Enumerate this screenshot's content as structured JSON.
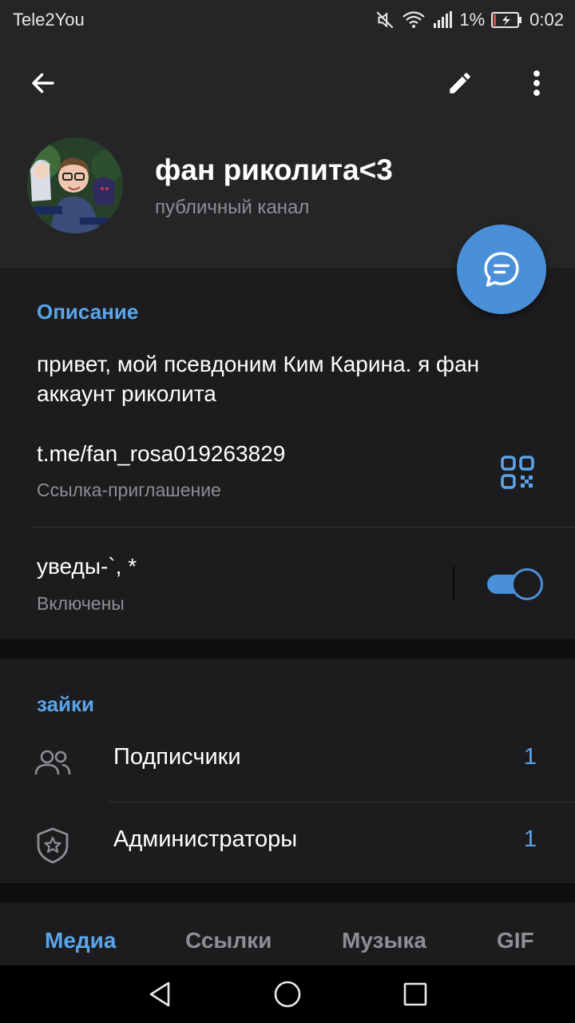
{
  "status_bar": {
    "carrier": "Tele2You",
    "battery": "1%",
    "time": "0:02",
    "icons": [
      "mute-icon",
      "wifi-icon",
      "signal-icon",
      "battery-charging-icon"
    ]
  },
  "header": {
    "back_icon": "arrow-left-icon",
    "edit_icon": "pencil-icon",
    "more_icon": "more-vertical-icon",
    "title": "фан риколита<3",
    "subtitle": "публичный канал"
  },
  "fab": {
    "icon": "chat-bubble-icon"
  },
  "info": {
    "description_title": "Описание",
    "description": "привет, мой псевдоним Ким Карина. я фан аккаунт риколита",
    "link": "t.me/fan_rosa019263829",
    "link_caption": "Ссылка-приглашение",
    "qr_icon": "qr-code-icon",
    "notifications_title": "уведы-`, *",
    "notifications_caption": "Включены",
    "notifications_enabled": true
  },
  "members": {
    "title": "зайки",
    "rows": [
      {
        "label": "Подписчики",
        "count": "1",
        "icon": "users-icon"
      },
      {
        "label": "Администраторы",
        "count": "1",
        "icon": "shield-star-icon"
      }
    ]
  },
  "tabs": [
    {
      "label": "Медиа",
      "active": true
    },
    {
      "label": "Ссылки",
      "active": false
    },
    {
      "label": "Музыка",
      "active": false
    },
    {
      "label": "GIF",
      "active": false
    }
  ],
  "colors": {
    "accent": "#4a90d9",
    "link_blue": "#5aa5ea",
    "background": "#1c1c1e",
    "header": "#252528"
  }
}
